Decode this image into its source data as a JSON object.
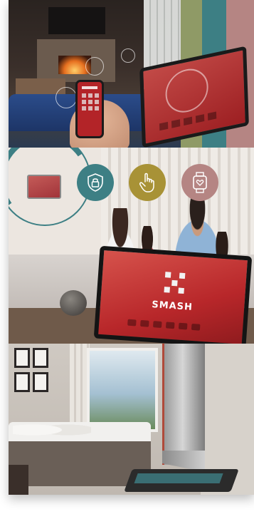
{
  "device": {
    "brand_text": "SMASH"
  },
  "icons": {
    "security": "lock-shield-icon",
    "touch": "hand-touch-icon",
    "wearable": "smartwatch-heart-icon"
  },
  "colors": {
    "teal": "#3d7f84",
    "olive": "#8f9a66",
    "mustard": "#a89236",
    "rose": "#b58583",
    "device_red": "#b8272a"
  }
}
